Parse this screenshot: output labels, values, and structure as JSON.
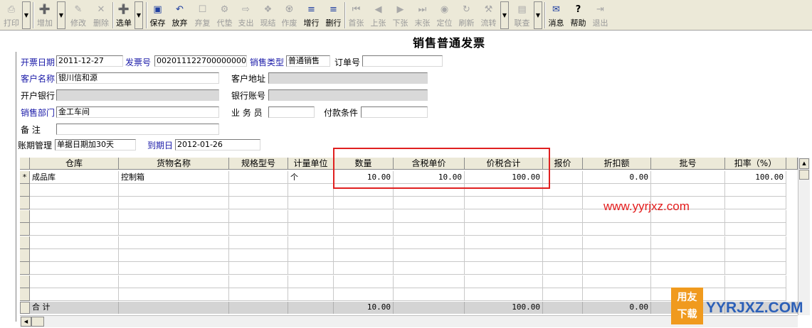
{
  "toolbar": {
    "buttons": [
      {
        "label": "打印",
        "icon": "printer-icon",
        "enabled": false
      },
      {
        "label": "增加",
        "icon": "add-document-icon",
        "enabled": false
      },
      {
        "label": "修改",
        "icon": "edit-pencil-icon",
        "enabled": false
      },
      {
        "label": "删除",
        "icon": "delete-x-icon",
        "enabled": false
      },
      {
        "label": "选单",
        "icon": "select-order-icon",
        "enabled": true
      },
      {
        "label": "保存",
        "icon": "save-disk-icon",
        "enabled": true
      },
      {
        "label": "放弃",
        "icon": "undo-arrow-icon",
        "enabled": true
      },
      {
        "label": "弃复",
        "icon": "restore-icon",
        "enabled": false
      },
      {
        "label": "代垫",
        "icon": "advance-payment-icon",
        "enabled": false
      },
      {
        "label": "支出",
        "icon": "expense-icon",
        "enabled": false
      },
      {
        "label": "现结",
        "icon": "cash-settle-icon",
        "enabled": false
      },
      {
        "label": "作废",
        "icon": "void-icon",
        "enabled": false
      },
      {
        "label": "增行",
        "icon": "insert-row-icon",
        "enabled": true
      },
      {
        "label": "删行",
        "icon": "delete-row-icon",
        "enabled": true
      },
      {
        "label": "首张",
        "icon": "first-record-icon",
        "enabled": false
      },
      {
        "label": "上张",
        "icon": "previous-record-icon",
        "enabled": false
      },
      {
        "label": "下张",
        "icon": "next-record-icon",
        "enabled": false
      },
      {
        "label": "末张",
        "icon": "last-record-icon",
        "enabled": false
      },
      {
        "label": "定位",
        "icon": "locate-icon",
        "enabled": false
      },
      {
        "label": "刷新",
        "icon": "refresh-icon",
        "enabled": false
      },
      {
        "label": "流转",
        "icon": "workflow-icon",
        "enabled": false
      },
      {
        "label": "联查",
        "icon": "linked-query-icon",
        "enabled": false
      },
      {
        "label": "消息",
        "icon": "message-icon",
        "enabled": true
      },
      {
        "label": "帮助",
        "icon": "help-question-icon",
        "enabled": true
      },
      {
        "label": "退出",
        "icon": "exit-door-icon",
        "enabled": false
      }
    ]
  },
  "form": {
    "title": "销售普通发票",
    "invoice_date_label": "开票日期",
    "invoice_date_value": "2011-12-27",
    "invoice_no_label": "发票号",
    "invoice_no_value": "00201112270000000001",
    "sales_type_label": "销售类型",
    "sales_type_value": "普通销售",
    "order_no_label": "订单号",
    "order_no_value": "",
    "customer_name_label": "客户名称",
    "customer_name_value": "银川信和源",
    "customer_address_label": "客户地址",
    "customer_address_value": "",
    "bank_label": "开户银行",
    "bank_value": "",
    "bank_account_label": "银行账号",
    "bank_account_value": "",
    "sales_dept_label": "销售部门",
    "sales_dept_value": "金工车间",
    "salesman_label": "业 务 员",
    "salesman_value": "",
    "payment_terms_label": "付款条件",
    "payment_terms_value": "",
    "remark_label": "备    注",
    "remark_value": "",
    "period_mgmt_label": "账期管理",
    "period_mgmt_value": "单据日期加30天",
    "due_date_label": "到期日",
    "due_date_value": "2012-01-26"
  },
  "grid": {
    "columns": [
      "仓库",
      "货物名称",
      "规格型号",
      "计量单位",
      "数量",
      "含税单价",
      "价税合计",
      "报价",
      "折扣额",
      "批号",
      "扣率（%）"
    ],
    "rows": [
      {
        "marker": "*",
        "warehouse": "成品库",
        "goods": "控制箱",
        "spec": "",
        "unit": "个",
        "qty": "10.00",
        "price": "10.00",
        "total": "100.00",
        "quote": "",
        "discount": "0.00",
        "batch": "",
        "rate": "100.00"
      }
    ],
    "summary": {
      "label": "合  计",
      "qty": "10.00",
      "total": "100.00",
      "discount": "0.00"
    }
  },
  "watermark": {
    "url": "www.yyrjxz.com",
    "logo_top": "用友",
    "logo_bottom": "下载",
    "logo_text": "YYRJXZ.COM"
  },
  "colors": {
    "highlight": "#e02020",
    "label_blue": "#1a1aa8",
    "watermark_red": "#e31c1c",
    "logo_orange": "#f09a1e"
  }
}
